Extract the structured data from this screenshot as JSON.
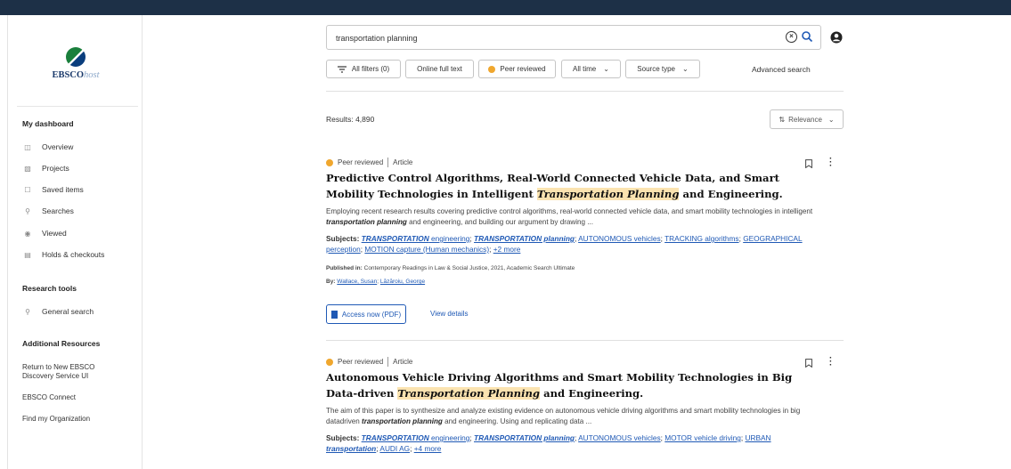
{
  "logo": {
    "brand": "EBSCO",
    "brand_suffix": "host"
  },
  "sidebar": {
    "dashboard_heading": "My dashboard",
    "dashboard_items": [
      {
        "label": "Overview",
        "icon": "overview-icon"
      },
      {
        "label": "Projects",
        "icon": "folder-icon"
      },
      {
        "label": "Saved items",
        "icon": "bookmark-icon"
      },
      {
        "label": "Searches",
        "icon": "search-icon"
      },
      {
        "label": "Viewed",
        "icon": "eye-icon"
      },
      {
        "label": "Holds & checkouts",
        "icon": "books-icon"
      }
    ],
    "research_heading": "Research tools",
    "research_items": [
      {
        "label": "General search",
        "icon": "search-icon"
      }
    ],
    "resources_heading": "Additional Resources",
    "resources_items": [
      {
        "label": "Return to New EBSCO Discovery Service UI"
      },
      {
        "label": "EBSCO Connect"
      },
      {
        "label": "Find my Organization"
      }
    ]
  },
  "search": {
    "query": "transportation planning"
  },
  "filters": {
    "all_filters": "All filters (0)",
    "online_full_text": "Online full text",
    "peer_reviewed": "Peer reviewed",
    "all_time": "All time",
    "source_type": "Source type",
    "advanced_search": "Advanced search"
  },
  "results": {
    "count_label": "Results: 4,890",
    "sort_label": "Relevance",
    "items": [
      {
        "review": "Peer reviewed",
        "type": "Article",
        "title_pre": "Predictive Control Algorithms, Real-World Connected Vehicle Data, and Smart Mobility Technologies in Intelligent ",
        "title_hl": "Transportation Planning",
        "title_post": " and Engineering.",
        "abstract_pre": "Employing recent research results covering predictive control algorithms, real-world connected vehicle data, and smart mobility technologies in intelligent ",
        "abstract_hl": "transportation planning",
        "abstract_post": " and engineering, and building our argument by drawing ...",
        "subjects_label": "Subjects:",
        "subjects": [
          {
            "b": "TRANSPORTATION",
            "rest": " engineering"
          },
          {
            "b": "TRANSPORTATION planning",
            "rest": ""
          },
          {
            "b": "",
            "rest": "AUTONOMOUS vehicles"
          },
          {
            "b": "",
            "rest": "TRACKING algorithms"
          },
          {
            "b": "",
            "rest": "GEOGRAPHICAL perception"
          },
          {
            "b": "",
            "rest": "MOTION capture (Human mechanics)"
          }
        ],
        "more_subjects": "+2 more",
        "published_label": "Published in:",
        "published": "Contemporary Readings in Law & Social Justice, 2021, Academic Search Ultimate",
        "by_label": "By:",
        "authors": [
          "Wallace, Susan",
          "Lăzăroiu, George"
        ],
        "access_label": "Access now (PDF)",
        "details_label": "View details"
      },
      {
        "review": "Peer reviewed",
        "type": "Article",
        "title_pre": "Autonomous Vehicle Driving Algorithms and Smart Mobility Technologies in Big Data-driven ",
        "title_hl": "Transportation Planning",
        "title_post": " and Engineering.",
        "abstract_pre": "The aim of this paper is to synthesize and analyze existing evidence on autonomous vehicle driving algorithms and smart mobility technologies in big datadriven ",
        "abstract_hl": "transportation planning",
        "abstract_post": " and engineering. Using and replicating data ...",
        "subjects_label": "Subjects:",
        "subjects": [
          {
            "b": "TRANSPORTATION",
            "rest": " engineering"
          },
          {
            "b": "TRANSPORTATION planning",
            "rest": ""
          },
          {
            "b": "",
            "rest": "AUTONOMOUS vehicles"
          },
          {
            "b": "",
            "rest": "MOTOR vehicle driving"
          },
          {
            "b": "transportation",
            "rest": "URBAN ",
            "b_after": true
          },
          {
            "b": "",
            "rest": "AUDI AG"
          }
        ],
        "more_subjects": "+4 more"
      }
    ]
  }
}
